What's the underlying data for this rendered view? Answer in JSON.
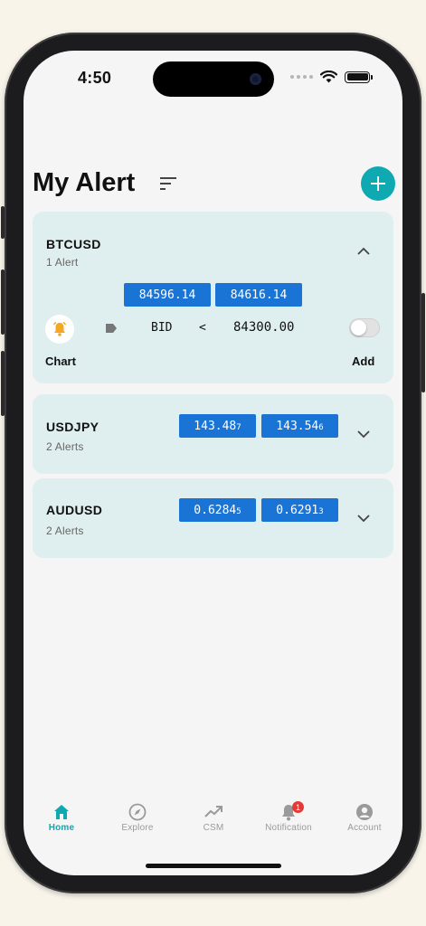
{
  "status": {
    "time": "4:50"
  },
  "header": {
    "title": "My Alert"
  },
  "alerts": [
    {
      "symbol": "BTCUSD",
      "count_label": "1 Alert",
      "bid": "84596.14",
      "ask": "84616.14",
      "expanded": true,
      "rule": {
        "side": "BID",
        "operator": "<",
        "price": "84300.00",
        "enabled": false
      },
      "chart_label": "Chart",
      "add_label": "Add"
    },
    {
      "symbol": "USDJPY",
      "count_label": "2 Alerts",
      "bid_main": "143.48",
      "bid_sub": "7",
      "ask_main": "143.54",
      "ask_sub": "6",
      "expanded": false
    },
    {
      "symbol": "AUDUSD",
      "count_label": "2 Alerts",
      "bid_main": "0.6284",
      "bid_sub": "5",
      "ask_main": "0.6291",
      "ask_sub": "3",
      "expanded": false
    }
  ],
  "tabs": [
    {
      "label": "Home",
      "icon": "home-icon",
      "active": true
    },
    {
      "label": "Explore",
      "icon": "compass-icon",
      "active": false
    },
    {
      "label": "CSM",
      "icon": "trend-icon",
      "active": false
    },
    {
      "label": "Notification",
      "icon": "bell-icon",
      "active": false,
      "badge": "1"
    },
    {
      "label": "Account",
      "icon": "account-icon",
      "active": false
    }
  ],
  "colors": {
    "accent": "#0fa9b1",
    "price_box": "#1a74d6",
    "card_bg": "#dfeeee",
    "bell": "#f5a623",
    "badge": "#e53935"
  }
}
